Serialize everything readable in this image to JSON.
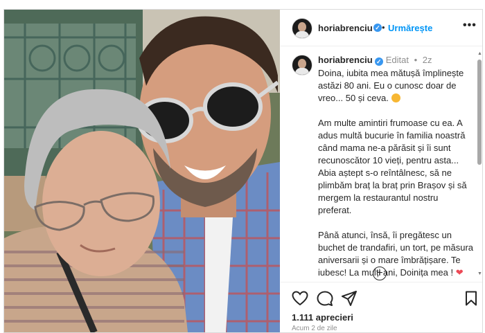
{
  "post": {
    "username": "horiabrenciu",
    "follow_label": "Urmărește",
    "edited_label": "Editat",
    "time_short": "2z",
    "caption_paragraphs": [
      "Doina, iubita mea mătușă împlinește astăzi 80 ani. Eu o cunosc doar de vreo... 50 și ceva.",
      "Am multe amintiri frumoase cu ea. A adus multă bucurie în familia noastră când mama ne-a părăsit și îi sunt recunoscător 10 vieți, pentru asta... Abia aștept s-o reîntâlnesc, să ne plimbăm braț la braț prin Brașov și să mergem la restaurantul nostru preferat.",
      "Până atunci, însă, îi pregătesc un buchet de trandafiri, un tort, pe măsura aniversarii și o mare îmbrățișare. Te iubesc! La mulți ani, Doinița mea !"
    ],
    "likes": "1.111 aprecieri",
    "time_ago": "Acum 2 de zile"
  },
  "icons": {
    "verified": "verified-badge-icon",
    "more": "more-options-icon",
    "like": "heart-icon",
    "comment": "comment-icon",
    "share": "share-icon",
    "save": "bookmark-icon",
    "add": "add-circle-icon"
  },
  "colors": {
    "accent": "#0095f6",
    "verified": "#3897f0",
    "muted": "#8e8e8e",
    "heart": "#ed4956"
  }
}
